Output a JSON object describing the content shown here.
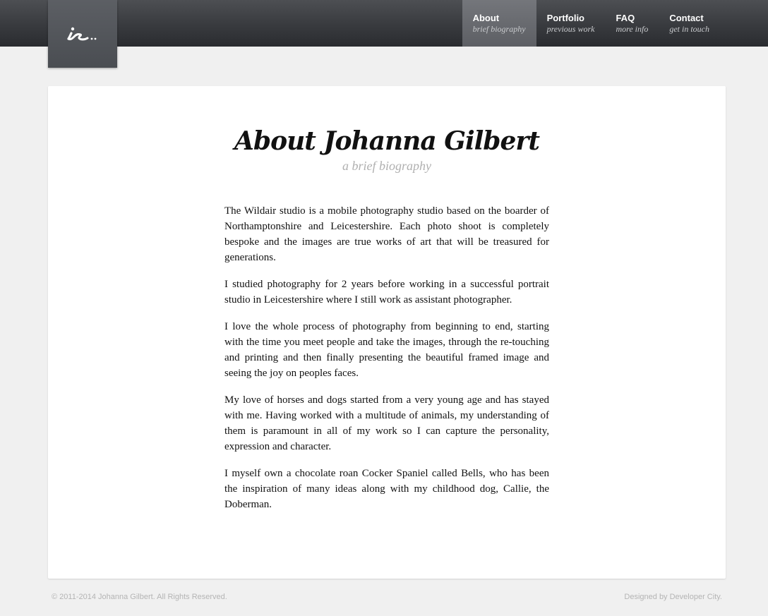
{
  "logo": {
    "text": "is..",
    "icon": "script-is-logo-icon"
  },
  "nav": {
    "items": [
      {
        "label": "About",
        "sub": "brief biography",
        "active": true
      },
      {
        "label": "Portfolio",
        "sub": "previous work",
        "active": false
      },
      {
        "label": "FAQ",
        "sub": "more info",
        "active": false
      },
      {
        "label": "Contact",
        "sub": "get in touch",
        "active": false
      }
    ]
  },
  "page": {
    "title": "About Johanna Gilbert",
    "subtitle": "a brief biography",
    "paragraphs": [
      "The Wildair studio is a mobile photography studio based on the boarder of Northamptonshire and Leicestershire. Each photo shoot is completely bespoke and the images are true works of art that will be treasured for generations.",
      "I studied photography for 2 years before working in a successful portrait studio in Leicestershire where I still work as assistant photographer.",
      "I love the whole process of photography from beginning to end, starting with the time you meet people and take the images, through the re-touching and printing and then finally presenting the beautiful framed image and seeing the joy on peoples faces.",
      "My love of horses and dogs started from a very young age and has stayed with me. Having worked with a multitude of animals, my understanding of them is paramount in all of my work so I can capture the personality, expression and character.",
      "I myself own a chocolate roan Cocker Spaniel called Bells, who has been the inspiration of many ideas along with my childhood dog, Callie, the Doberman."
    ]
  },
  "footer": {
    "copyright": "© 2011-2014 Johanna Gilbert. All Rights Reserved.",
    "credit": "Designed by Developer City."
  },
  "colors": {
    "topbar": "#3a3c40",
    "active_nav": "#6a6c71",
    "background": "#f0f0f0",
    "subtitle": "#b0b0b0",
    "footer_text": "#b4b4b4"
  }
}
